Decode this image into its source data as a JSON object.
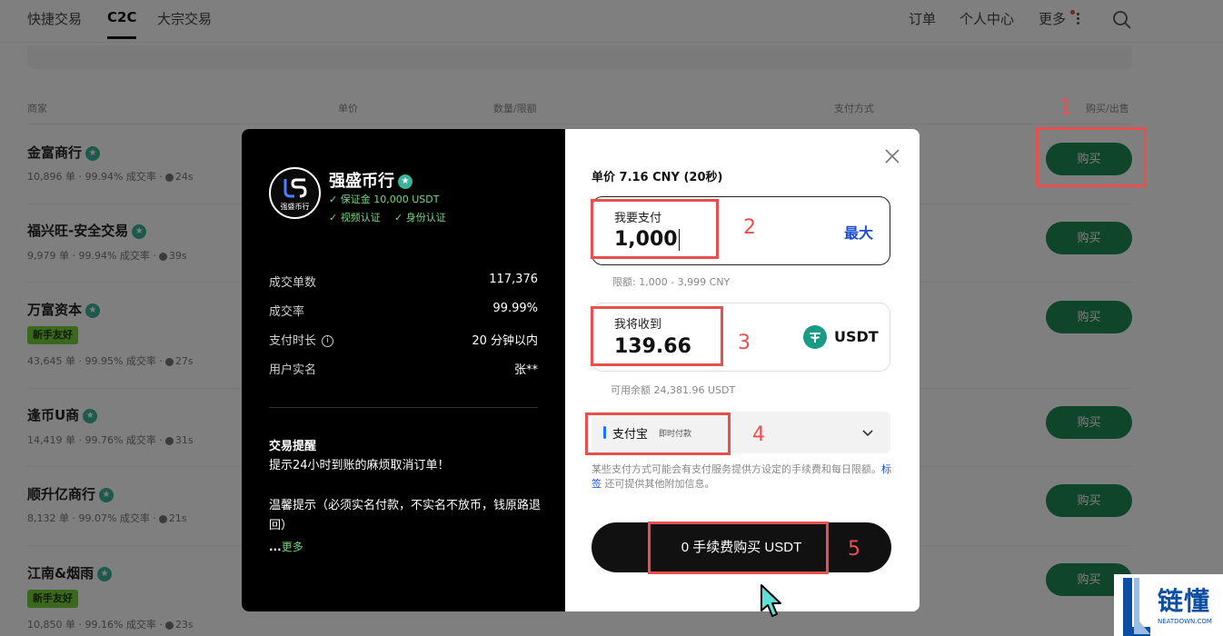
{
  "nav": {
    "tabs": [
      {
        "label": "快捷交易"
      },
      {
        "label": "C2C",
        "active": true
      },
      {
        "label": "大宗交易"
      }
    ],
    "right": {
      "orders": "订单",
      "profile": "个人中心",
      "more": "更多"
    }
  },
  "table": {
    "headers": {
      "merchant": "商家",
      "price": "单价",
      "amount": "数量/限额",
      "payment": "支付方式",
      "action": "购买/出售"
    },
    "rows": [
      {
        "name": "金富商行",
        "stats": "10,896 单 · 99.94% 成交率 ·",
        "time": "24s",
        "action": "购买"
      },
      {
        "name": "福兴旺-安全交易",
        "stats": "9,979 单 · 99.94% 成交率 ·",
        "time": "39s",
        "action": "购买"
      },
      {
        "name": "万富资本",
        "tag": "新手友好",
        "stats": "43,645 单 · 99.95% 成交率 ·",
        "time": "27s",
        "action": "购买"
      },
      {
        "name": "逢币U商",
        "stats": "14,419 单 · 99.76% 成交率 ·",
        "time": "31s",
        "action": "购买"
      },
      {
        "name": "顺升亿商行",
        "stats": "8,132 单 · 99.07% 成交率 ·",
        "time": "21s",
        "action": "购买"
      },
      {
        "name": "江南&烟雨",
        "tag": "新手友好",
        "stats": "10,850 单 · 99.16% 成交率 ·",
        "time": "23s",
        "action": "购买"
      }
    ]
  },
  "annotations": [
    "1",
    "2",
    "3",
    "4",
    "5"
  ],
  "modal": {
    "merchant": {
      "logo_text": "强盛币行",
      "name": "强盛币行",
      "deposit": "✓ 保证金 10,000 USDT",
      "video_cert": "✓ 视频认证",
      "id_cert": "✓ 身份认证"
    },
    "stats": [
      {
        "label": "成交单数",
        "value": "117,376"
      },
      {
        "label": "成交率",
        "value": "99.99%"
      },
      {
        "label": "支付时长",
        "value": "20 分钟以内"
      },
      {
        "label": "用户实名",
        "value": "张**"
      }
    ],
    "notice": {
      "title": "交易提醒",
      "line1": "提示24小时到账的麻烦取消订单！",
      "line2": "温馨提示（必须实名付款，不实名不放币，钱原路退回）",
      "more_prefix": "...",
      "more": "更多"
    },
    "order": {
      "unit_price": "单价 7.16 CNY (20秒)",
      "pay_label": "我要支付",
      "pay_value": "1,000",
      "max": "最大",
      "limit": "限额: 1,000 - 3,999 CNY",
      "receive_label": "我将收到",
      "receive_value": "139.66",
      "currency": "USDT",
      "available": "可用余额 24,381.96 USDT",
      "payment_method": "支付宝",
      "payment_sub": "即时付款",
      "fee_note_1": "某些支付方式可能会有支付服务提供方设定的手续费和每日限额。",
      "fee_note_link": "标签",
      "fee_note_2": " 还可提供其他附加信息。",
      "submit": "0 手续费购买 USDT"
    }
  },
  "watermark": {
    "text": "链懂",
    "sub": "NEATDOWN.COM"
  },
  "colors": {
    "accent_green": "#1f8a55",
    "annotation_red": "#e8504f",
    "link_blue": "#1d4fd6"
  }
}
